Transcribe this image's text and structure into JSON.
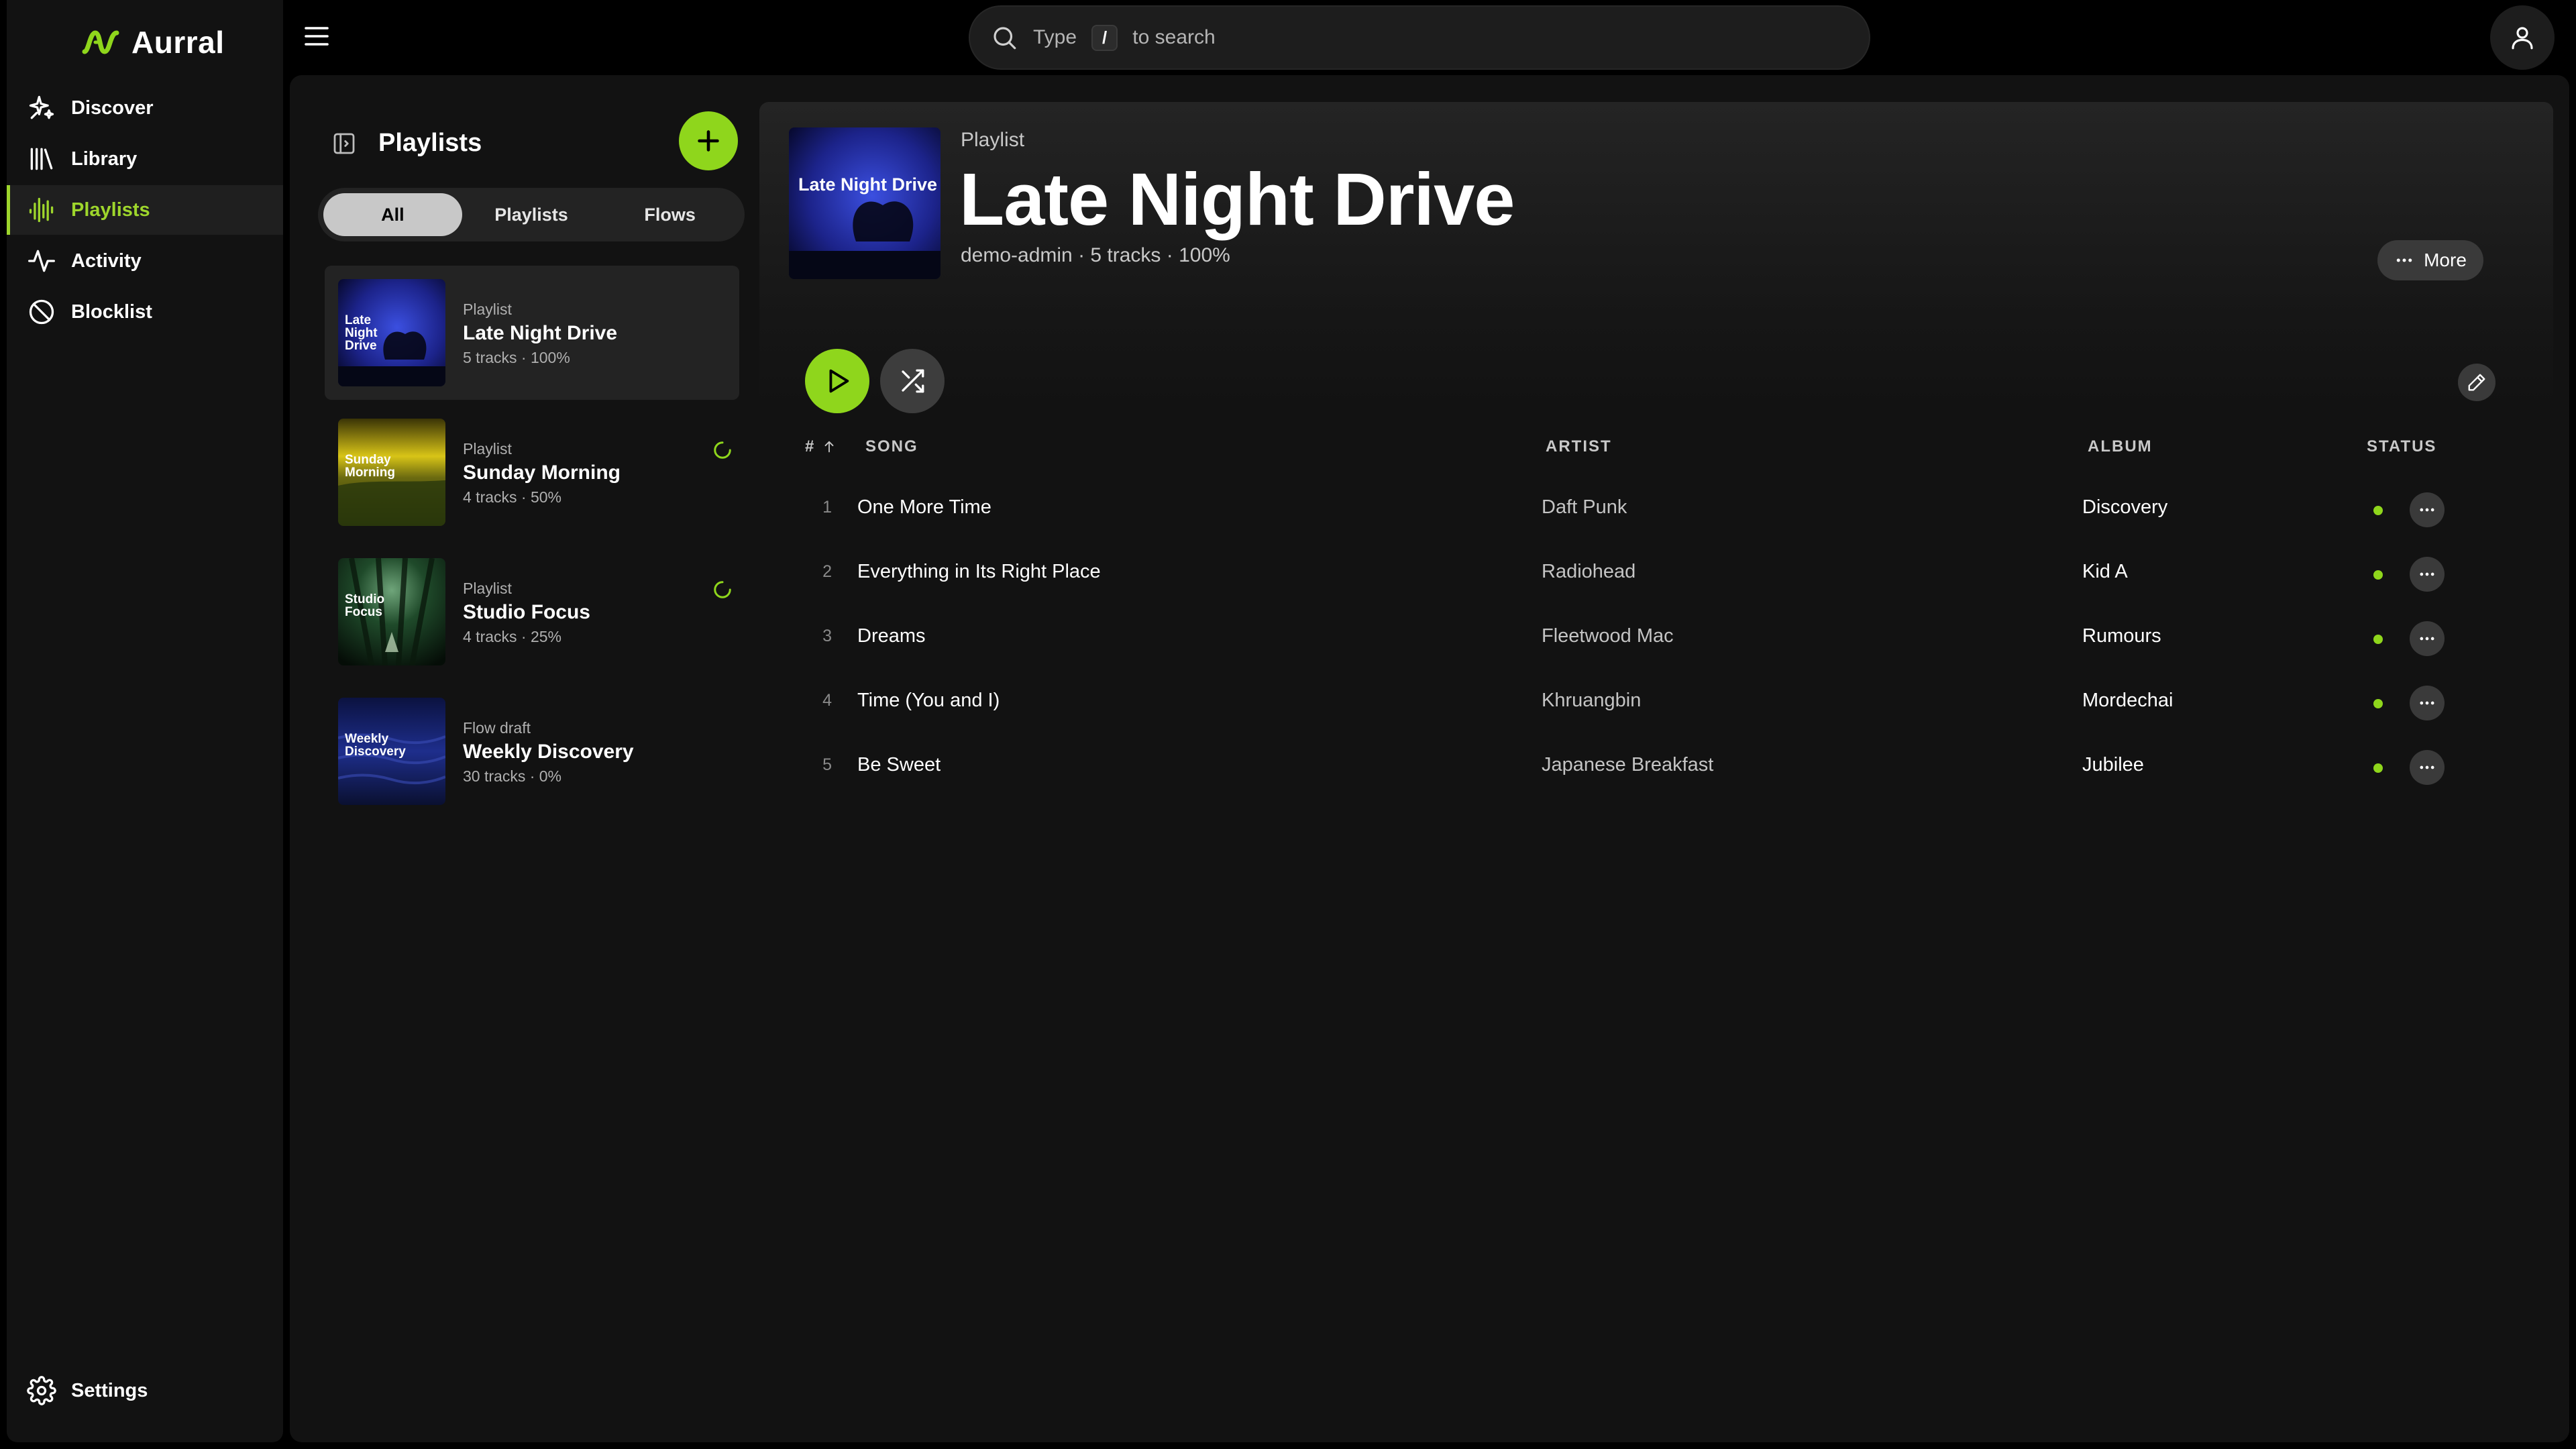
{
  "app": {
    "name": "Aurral"
  },
  "sidebar": {
    "items": [
      {
        "label": "Discover",
        "icon": "discover-icon"
      },
      {
        "label": "Library",
        "icon": "library-icon"
      },
      {
        "label": "Playlists",
        "icon": "playlists-icon",
        "active": true
      },
      {
        "label": "Activity",
        "icon": "activity-icon"
      },
      {
        "label": "Blocklist",
        "icon": "blocklist-icon"
      }
    ],
    "settings_label": "Settings"
  },
  "search": {
    "prefix": "Type",
    "key": "/",
    "suffix": "to search"
  },
  "playlists_panel": {
    "title": "Playlists",
    "tabs": [
      {
        "label": "All",
        "active": true
      },
      {
        "label": "Playlists"
      },
      {
        "label": "Flows"
      }
    ],
    "items": [
      {
        "kind": "Playlist",
        "name": "Late Night Drive",
        "meta": "5 tracks · 100%",
        "cover_text": "Late Night Drive",
        "active": true,
        "syncing": false
      },
      {
        "kind": "Playlist",
        "name": "Sunday Morning",
        "meta": "4 tracks · 50%",
        "cover_text": "Sunday Morning",
        "syncing": true
      },
      {
        "kind": "Playlist",
        "name": "Studio Focus",
        "meta": "4 tracks · 25%",
        "cover_text": "Studio Focus",
        "syncing": true
      },
      {
        "kind": "Flow draft",
        "name": "Weekly Discovery",
        "meta": "30 tracks · 0%",
        "cover_text": "Weekly Discovery",
        "syncing": false
      }
    ]
  },
  "detail": {
    "kind": "Playlist",
    "title": "Late Night Drive",
    "cover_text": "Late Night Drive",
    "meta": "demo-admin · 5 tracks · 100%",
    "more_label": "More",
    "columns": {
      "num": "#",
      "song": "SONG",
      "artist": "ARTIST",
      "album": "ALBUM",
      "status": "STATUS"
    },
    "tracks": [
      {
        "num": "1",
        "song": "One More Time",
        "artist": "Daft Punk",
        "album": "Discovery"
      },
      {
        "num": "2",
        "song": "Everything in Its Right Place",
        "artist": "Radiohead",
        "album": "Kid A"
      },
      {
        "num": "3",
        "song": "Dreams",
        "artist": "Fleetwood Mac",
        "album": "Rumours"
      },
      {
        "num": "4",
        "song": "Time (You and I)",
        "artist": "Khruangbin",
        "album": "Mordechai"
      },
      {
        "num": "5",
        "song": "Be Sweet",
        "artist": "Japanese Breakfast",
        "album": "Jubilee"
      }
    ]
  },
  "colors": {
    "accent": "#8fd61c",
    "background": "#000000",
    "panel": "#121212"
  }
}
